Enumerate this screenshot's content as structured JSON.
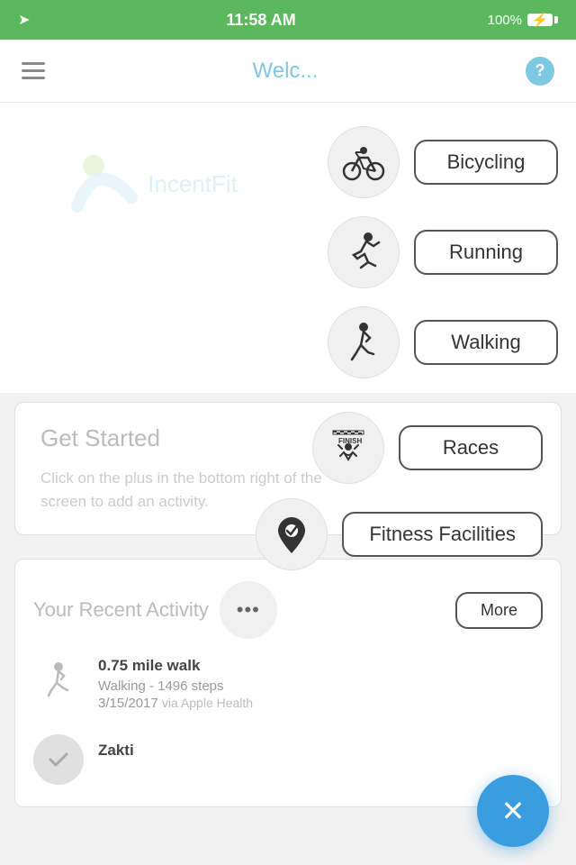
{
  "status_bar": {
    "time": "11:58 AM",
    "signal": "▶",
    "battery_pct": "100%"
  },
  "header": {
    "title": "Welcome",
    "title_short": "Welc",
    "help_label": "?"
  },
  "activities": [
    {
      "id": "bicycling",
      "label": "Bicycling",
      "icon": "🚴"
    },
    {
      "id": "running",
      "label": "Running",
      "icon": "🏃"
    },
    {
      "id": "walking",
      "label": "Walking",
      "icon": "🚶"
    }
  ],
  "get_started": {
    "title": "Get Started",
    "body": "Click on the plus in the bottom right of the screen to add an activity."
  },
  "get_started_overlays": [
    {
      "id": "races",
      "label": "Races",
      "icon": "🏁"
    },
    {
      "id": "fitness",
      "label": "Fitness Facilities",
      "icon": "📍"
    }
  ],
  "recent_activity": {
    "title": "Your Recent Activity",
    "more_label": "More",
    "items": [
      {
        "id": "walk1",
        "title": "0.75 mile walk",
        "subtitle": "Walking - 1496 steps",
        "date": "3/15/2017",
        "via": "via Apple Health",
        "icon_type": "walk"
      },
      {
        "id": "zakti1",
        "title": "Zakti",
        "icon_type": "check"
      }
    ]
  },
  "fab": {
    "label": "✕"
  },
  "logo": {
    "name": "IncentFit"
  }
}
